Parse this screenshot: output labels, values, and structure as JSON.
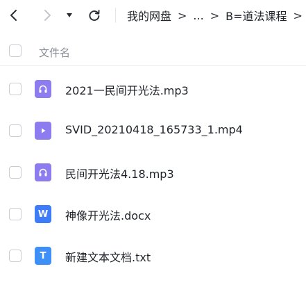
{
  "breadcrumb": {
    "root": "我的网盘",
    "sep1": ">",
    "ellipsis": "...",
    "sep2": ">",
    "current": "B=道法课程",
    "sep3": ">"
  },
  "list_header": {
    "name_label": "文件名"
  },
  "files": [
    {
      "name": "2021一民间开光法.mp3",
      "type": "audio",
      "icon": "headphones-icon",
      "color": "#8c7cf0"
    },
    {
      "name": "SVID_20210418_165733_1.mp4",
      "type": "video",
      "icon": "play-icon",
      "color": "#8c7cf0"
    },
    {
      "name": "民间开光法4.18.mp3",
      "type": "audio",
      "icon": "headphones-icon",
      "color": "#8c7cf0"
    },
    {
      "name": "神像开光法.docx",
      "type": "word",
      "icon": "word-doc-icon",
      "icon_letter": "W",
      "color": "#3e7cf7"
    },
    {
      "name": "新建文本文档.txt",
      "type": "text",
      "icon": "text-doc-icon",
      "icon_letter": "T",
      "color": "#3e8ff7"
    }
  ]
}
